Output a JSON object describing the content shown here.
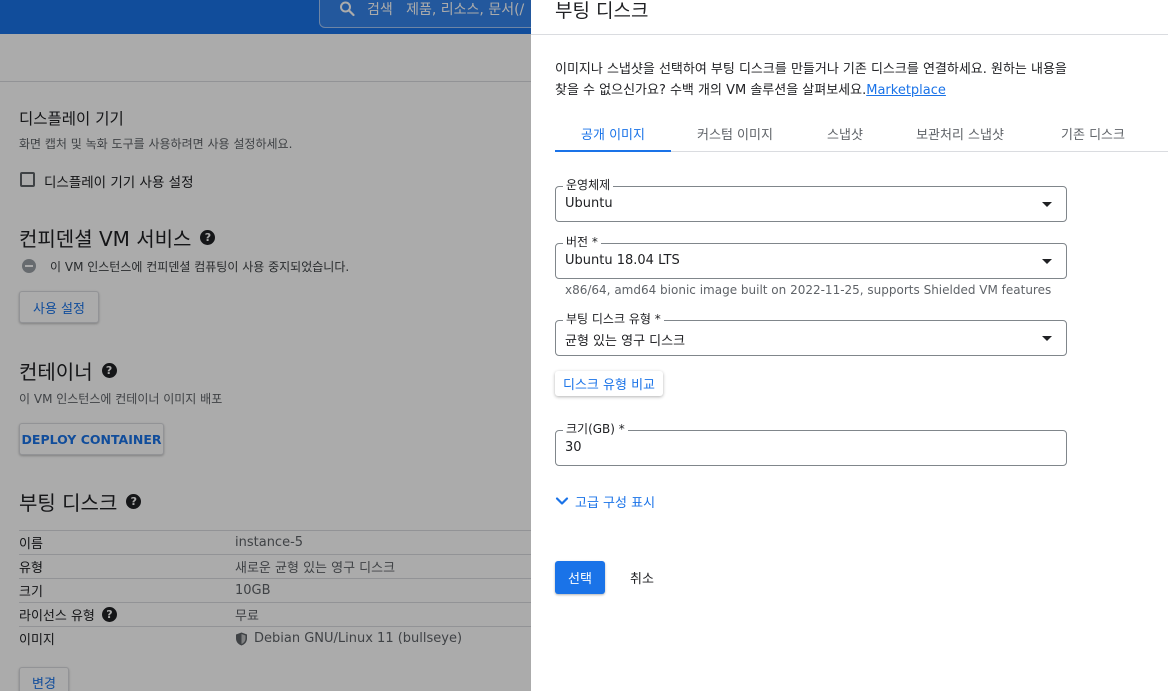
{
  "colors": {
    "accent": "#1a73e8",
    "overlay": "rgba(0,0,0,0.33)"
  },
  "background": {
    "search": {
      "label": "검색",
      "placeholder": "제품, 리소스, 문서(/"
    },
    "display_device": {
      "title": "디스플레이 기기",
      "description": "화면 캡처 및 녹화 도구를 사용하려면 사용 설정하세요.",
      "checkbox_label": "디스플레이 기기 사용 설정"
    },
    "confidential_vm": {
      "title": "컨피덴셜 VM 서비스",
      "status": "이 VM 인스턴스에 컨피덴셜 컴퓨팅이 사용 중지되었습니다.",
      "enable_button": "사용 설정"
    },
    "container": {
      "title": "컨테이너",
      "description": "이 VM 인스턴스에 컨테이너 이미지 배포",
      "deploy_button": "DEPLOY CONTAINER"
    },
    "boot_disk": {
      "title": "부팅 디스크",
      "rows": [
        {
          "key": "이름",
          "value": "instance-5"
        },
        {
          "key": "유형",
          "value": "새로운 균형 있는 영구 디스크"
        },
        {
          "key": "크기",
          "value": "10GB"
        },
        {
          "key": "라이선스 유형",
          "value": "무료"
        },
        {
          "key": "이미지",
          "value": "Debian GNU/Linux 11 (bullseye)"
        }
      ],
      "change_button": "변경"
    }
  },
  "panel": {
    "title": "부팅 디스크",
    "description": "이미지나 스냅샷을 선택하여 부팅 디스크를 만들거나 기존 디스크를 연결하세요. 원하는 내용을 찾을 수 없으신가요? 수백 개의 VM 솔루션을 살펴보세요.",
    "marketplace_link": "Marketplace",
    "tabs": [
      {
        "label": "공개 이미지",
        "active": true
      },
      {
        "label": "커스텀 이미지",
        "active": false
      },
      {
        "label": "스냅샷",
        "active": false
      },
      {
        "label": "보관처리 스냅샷",
        "active": false
      },
      {
        "label": "기존 디스크",
        "active": false
      }
    ],
    "os": {
      "label": "운영체제",
      "value": "Ubuntu"
    },
    "version": {
      "label": "버전 *",
      "value": "Ubuntu 18.04 LTS",
      "hint": "x86/64, amd64 bionic image built on 2022-11-25, supports Shielded VM features"
    },
    "disk_type": {
      "label": "부팅 디스크 유형 *",
      "value": "균형 있는 영구 디스크"
    },
    "compare_button": "디스크 유형 비교",
    "size": {
      "label": "크기(GB) *",
      "value": "30"
    },
    "advanced_toggle": "고급 구성 표시",
    "select_button": "선택",
    "cancel_button": "취소"
  }
}
